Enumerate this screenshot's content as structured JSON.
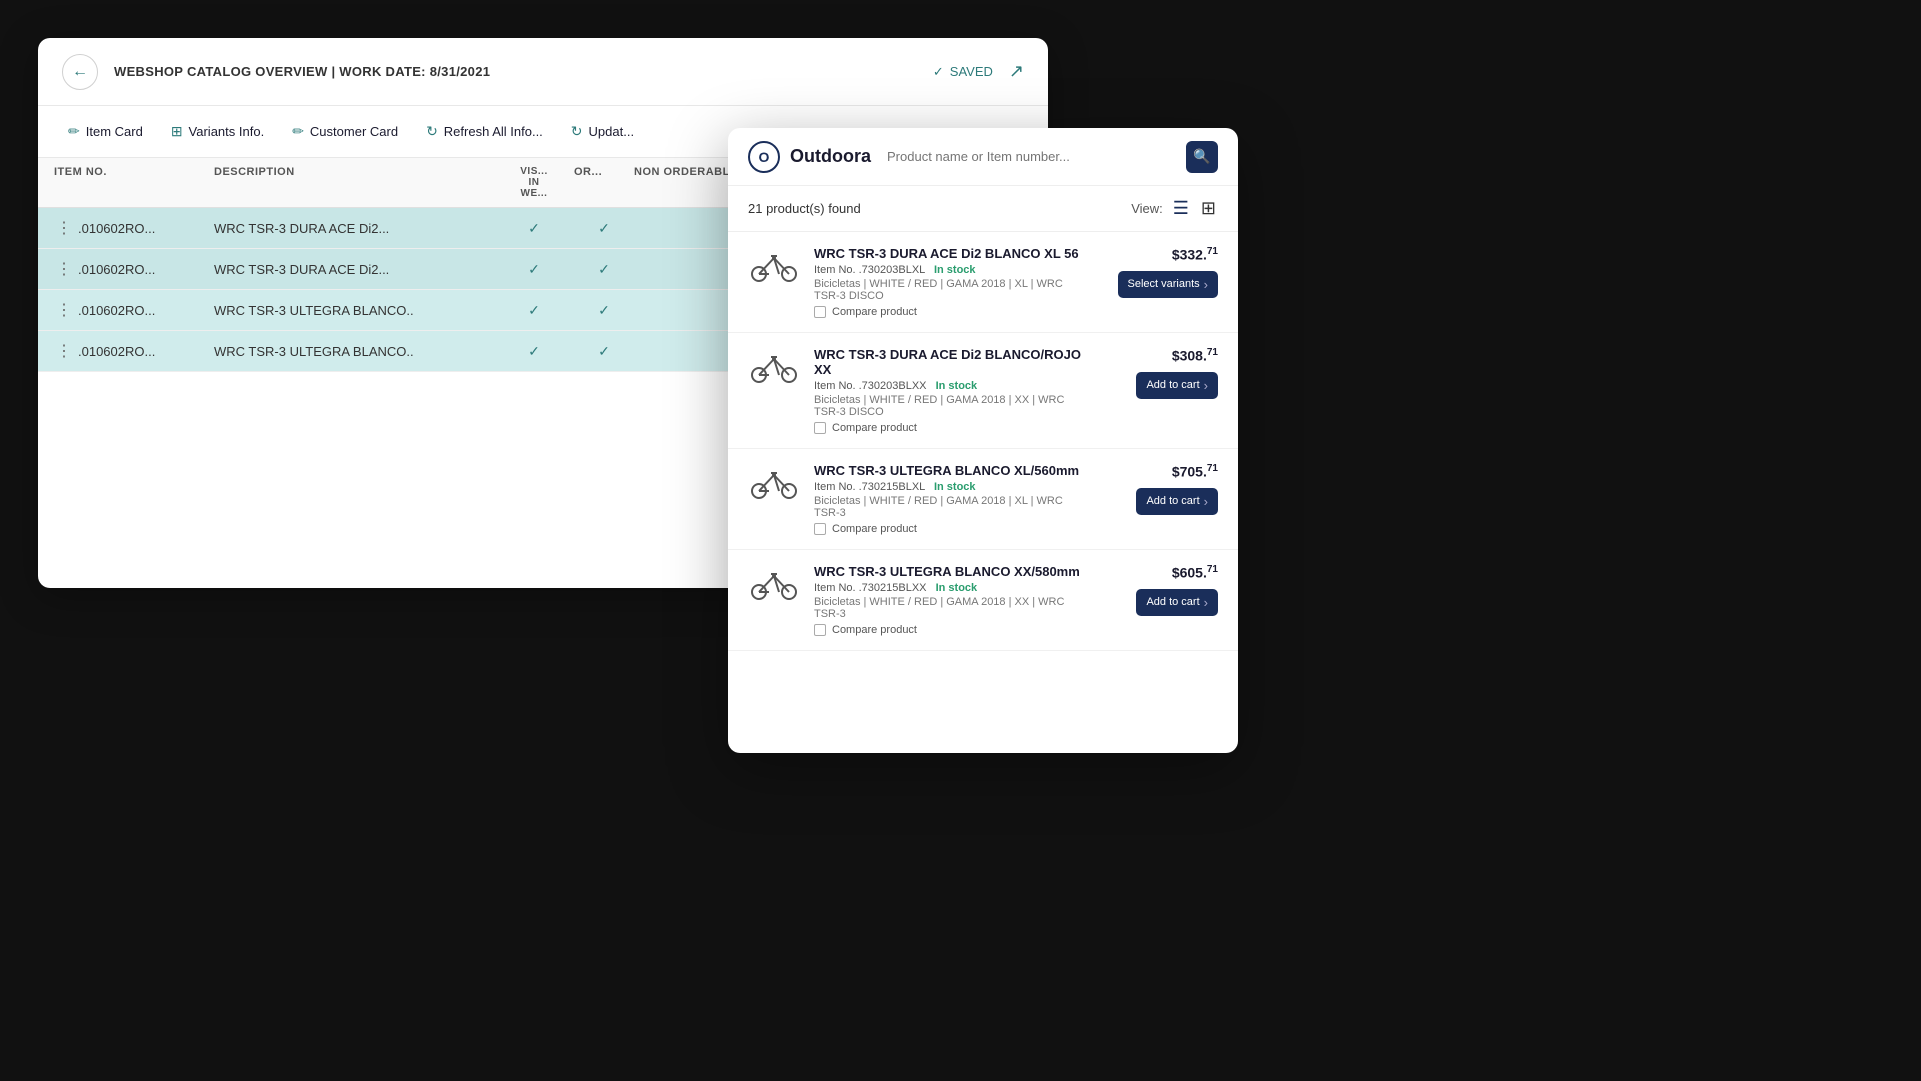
{
  "main_window": {
    "title": "WEBSHOP CATALOG OVERVIEW | WORK DATE: 8/31/2021",
    "saved_label": "SAVED",
    "toolbar": {
      "item_card": "Item Card",
      "variants_info": "Variants Info.",
      "customer_card": "Customer Card",
      "refresh_all_info": "Refresh All Info...",
      "update": "Updat..."
    },
    "table": {
      "columns": [
        "ITEM NO.",
        "DESCRIPTION",
        "VIS... IN WE...",
        "OR...",
        "NON ORDERABLE REA..."
      ],
      "rows": [
        {
          "item_no": ".010602RO...",
          "description": "WRC  TSR-3 DURA ACE Di2...",
          "vis": true,
          "or": true
        },
        {
          "item_no": ".010602RO...",
          "description": "WRC  TSR-3 DURA ACE Di2...",
          "vis": true,
          "or": true
        },
        {
          "item_no": ".010602RO...",
          "description": "WRC  TSR-3 ULTEGRA BLANCO..",
          "vis": true,
          "or": true
        },
        {
          "item_no": ".010602RO...",
          "description": "WRC  TSR-3 ULTEGRA BLANCO..",
          "vis": true,
          "or": true
        }
      ]
    }
  },
  "popup": {
    "logo_text": "Outdoora",
    "search_placeholder": "Product name or Item number...",
    "products_found": "21 product(s) found",
    "view_label": "View:",
    "products": [
      {
        "name": "WRC TSR-3 DURA ACE Di2 BLANCO XL 56",
        "price": "$332.",
        "price_sup": "71",
        "item_no": ".730203BLXL",
        "in_stock": "In stock",
        "tags": "Bicicletas | WHITE / RED | GAMA 2018 | XL | WRC TSR-3 DISCO",
        "action": "Select variants"
      },
      {
        "name": "WRC TSR-3 DURA ACE Di2 BLANCO/ROJO XX",
        "price": "$308.",
        "price_sup": "71",
        "item_no": ".730203BLXX",
        "in_stock": "In stock",
        "tags": "Bicicletas | WHITE / RED | GAMA 2018 | XX | WRC TSR-3 DISCO",
        "action": "Add to cart"
      },
      {
        "name": "WRC TSR-3 ULTEGRA BLANCO XL/560mm",
        "price": "$705.",
        "price_sup": "71",
        "item_no": ".730215BLXL",
        "in_stock": "In stock",
        "tags": "Bicicletas | WHITE / RED | GAMA 2018 | XL | WRC TSR-3",
        "action": "Add to cart"
      },
      {
        "name": "WRC TSR-3 ULTEGRA BLANCO XX/580mm",
        "price": "$605.",
        "price_sup": "71",
        "item_no": ".730215BLXX",
        "in_stock": "In stock",
        "tags": "Bicicletas | WHITE / RED | GAMA 2018 | XX | WRC TSR-3",
        "action": "Add to cart"
      }
    ],
    "compare_label": "Compare product"
  }
}
